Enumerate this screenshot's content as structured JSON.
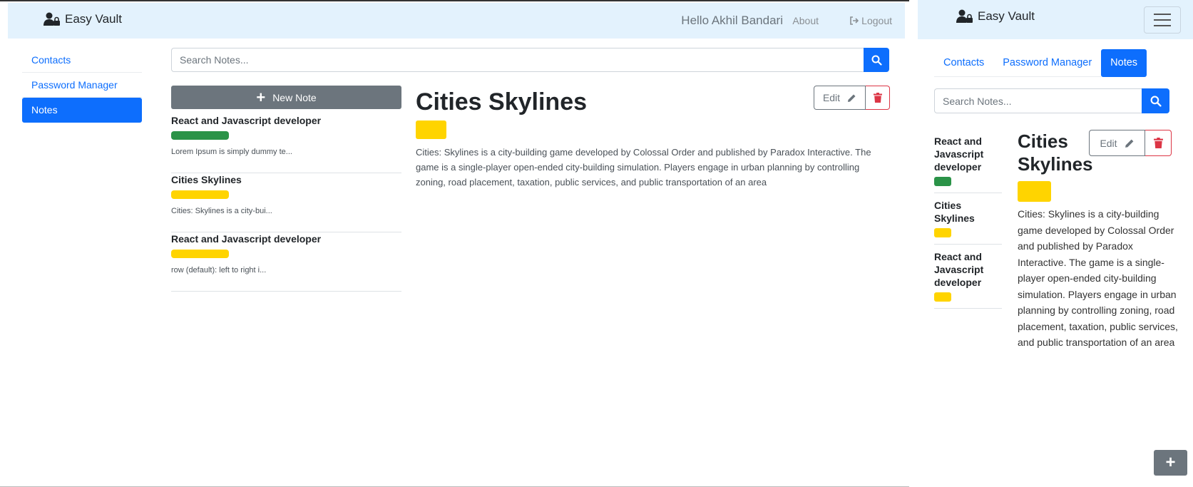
{
  "app": {
    "brand": "Easy Vault"
  },
  "desktop": {
    "greeting": "Hello Akhil Bandari",
    "about": "About",
    "logout": "Logout",
    "sidebar": [
      {
        "label": "Contacts",
        "active": false
      },
      {
        "label": "Password Manager",
        "active": false
      },
      {
        "label": "Notes",
        "active": true
      }
    ],
    "search_placeholder": "Search Notes...",
    "new_note": "New Note",
    "notes": [
      {
        "title": "React and Javascript developer",
        "color": "#2b9348",
        "snippet": "Lorem Ipsum is simply dummy te..."
      },
      {
        "title": "Cities Skylines",
        "color": "#ffd400",
        "snippet": "Cities: Skylines is a city-bui..."
      },
      {
        "title": "React and Javascript developer",
        "color": "#ffd400",
        "snippet": "row (default): left to right i..."
      }
    ],
    "detail": {
      "title": "Cities Skylines",
      "color": "#ffd400",
      "body": "Cities: Skylines is a city-building game developed by Colossal Order and published by Paradox Interactive. The game is a single-player open-ended city-building simulation. Players engage in urban planning by controlling zoning, road placement, taxation, public services, and public transportation of an area",
      "edit": "Edit"
    }
  },
  "mobile": {
    "tabs": [
      {
        "label": "Contacts",
        "active": false
      },
      {
        "label": "Password Manager",
        "active": false
      },
      {
        "label": "Notes",
        "active": true
      }
    ],
    "search_placeholder": "Search Notes...",
    "notes": [
      {
        "title": "React and Javascript developer",
        "color": "#2b9348"
      },
      {
        "title": "Cities Skylines",
        "color": "#ffd400"
      },
      {
        "title": "React and Javascript developer",
        "color": "#ffd400"
      }
    ],
    "detail": {
      "title": "Cities Skylines",
      "color": "#ffd400",
      "body": "Cities: Skylines is a city-building game developed by Colossal Order and published by Paradox Interactive. The game is a single-player open-ended city-building simulation. Players engage in urban planning by controlling zoning, road placement, taxation, public services, and public transportation of an area",
      "edit": "Edit"
    },
    "fab": "+"
  },
  "colors": {
    "primary": "#0d6efd",
    "secondary": "#6c757d",
    "danger": "#dc3545",
    "navbar": "#e3f2fd"
  }
}
